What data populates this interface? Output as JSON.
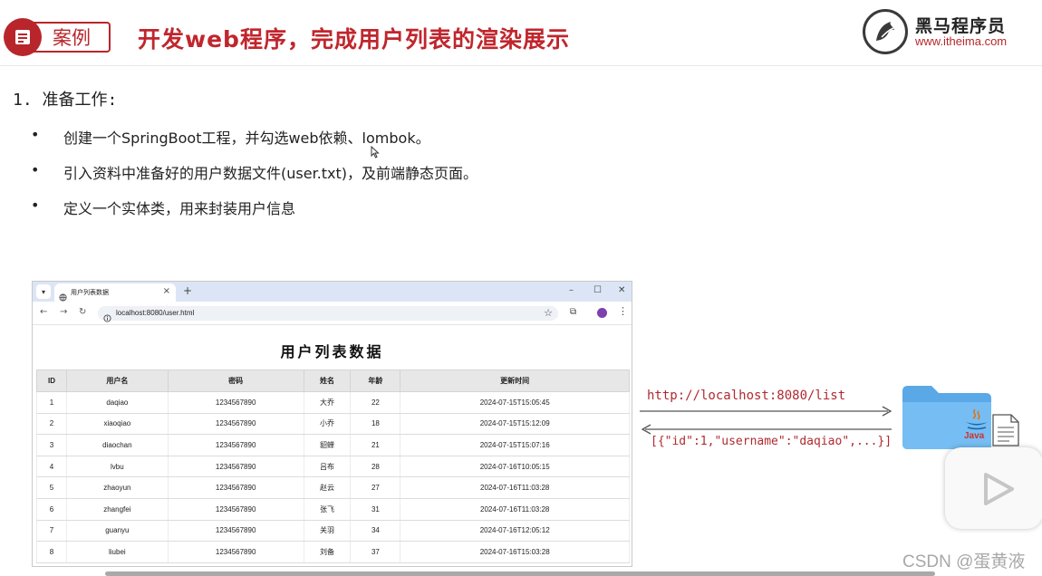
{
  "header": {
    "badge": "案例",
    "title": "开发web程序，完成用户列表的渲染展示",
    "logo_cn": "黑马程序员",
    "logo_url": "www.itheima.com"
  },
  "content": {
    "heading": "1. 准备工作:",
    "bullets": [
      "创建一个SpringBoot工程，并勾选web依赖、lombok。",
      "引入资料中准备好的用户数据文件(user.txt)，及前端静态页面。",
      "定义一个实体类，用来封装用户信息"
    ]
  },
  "browser": {
    "tab_title": "用户列表数据",
    "url": "localhost:8080/user.html",
    "page_title": "用户列表数据",
    "columns": [
      "ID",
      "用户名",
      "密码",
      "姓名",
      "年龄",
      "更新时间"
    ],
    "rows": [
      [
        "1",
        "daqiao",
        "1234567890",
        "大乔",
        "22",
        "2024-07-15T15:05:45"
      ],
      [
        "2",
        "xiaoqiao",
        "1234567890",
        "小乔",
        "18",
        "2024-07-15T15:12:09"
      ],
      [
        "3",
        "diaochan",
        "1234567890",
        "貂蝉",
        "21",
        "2024-07-15T15:07:16"
      ],
      [
        "4",
        "lvbu",
        "1234567890",
        "吕布",
        "28",
        "2024-07-16T10:05:15"
      ],
      [
        "5",
        "zhaoyun",
        "1234567890",
        "赵云",
        "27",
        "2024-07-16T11:03:28"
      ],
      [
        "6",
        "zhangfei",
        "1234567890",
        "张飞",
        "31",
        "2024-07-16T11:03:28"
      ],
      [
        "7",
        "guanyu",
        "1234567890",
        "关羽",
        "34",
        "2024-07-16T12:05:12"
      ],
      [
        "8",
        "liubei",
        "1234567890",
        "刘备",
        "37",
        "2024-07-16T15:03:28"
      ]
    ]
  },
  "diagram": {
    "request_url": "http://localhost:8080/list",
    "response_json": "[{\"id\":1,\"username\":\"daqiao\",...}]",
    "java_label": "Java"
  },
  "watermark": "CSDN @蛋黄液",
  "colors": {
    "accent": "#b8262b",
    "title": "#c0262d",
    "code": "#b02a30"
  },
  "icons": {
    "badge": "document-icon",
    "logo": "horse-logo-icon",
    "play": "play-icon",
    "folder": "folder-icon"
  }
}
